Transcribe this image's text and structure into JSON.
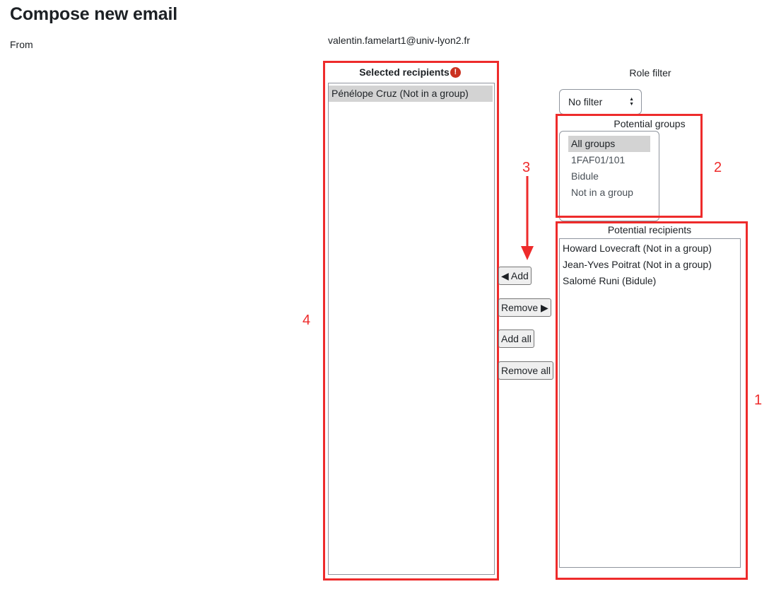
{
  "page": {
    "title": "Compose new email",
    "from_label": "From",
    "from_value": "valentin.famelart1@univ-lyon2.fr"
  },
  "selected": {
    "title": "Selected recipients",
    "required_icon": "!",
    "items": [
      "Pénélope Cruz (Not in a group)"
    ]
  },
  "buttons": {
    "add": "◀ Add",
    "remove": "Remove ▶",
    "add_all": "Add all",
    "remove_all": "Remove all"
  },
  "role_filter": {
    "label": "Role filter",
    "selected": "No filter"
  },
  "groups": {
    "title": "Potential groups",
    "items": [
      "All groups",
      "1FAF01/101",
      "Bidule",
      "Not in a group"
    ]
  },
  "recipients": {
    "title": "Potential recipients",
    "items": [
      "Howard Lovecraft (Not in a group)",
      "Jean-Yves Poitrat (Not in a group)",
      "Salomé Runi (Bidule)"
    ]
  },
  "annotations": {
    "n1": "1",
    "n2": "2",
    "n3": "3",
    "n4": "4"
  },
  "colors": {
    "annotation_red": "#ee2b2b",
    "selected_option": "#d3d3d3",
    "required_icon": "#ca3120"
  }
}
